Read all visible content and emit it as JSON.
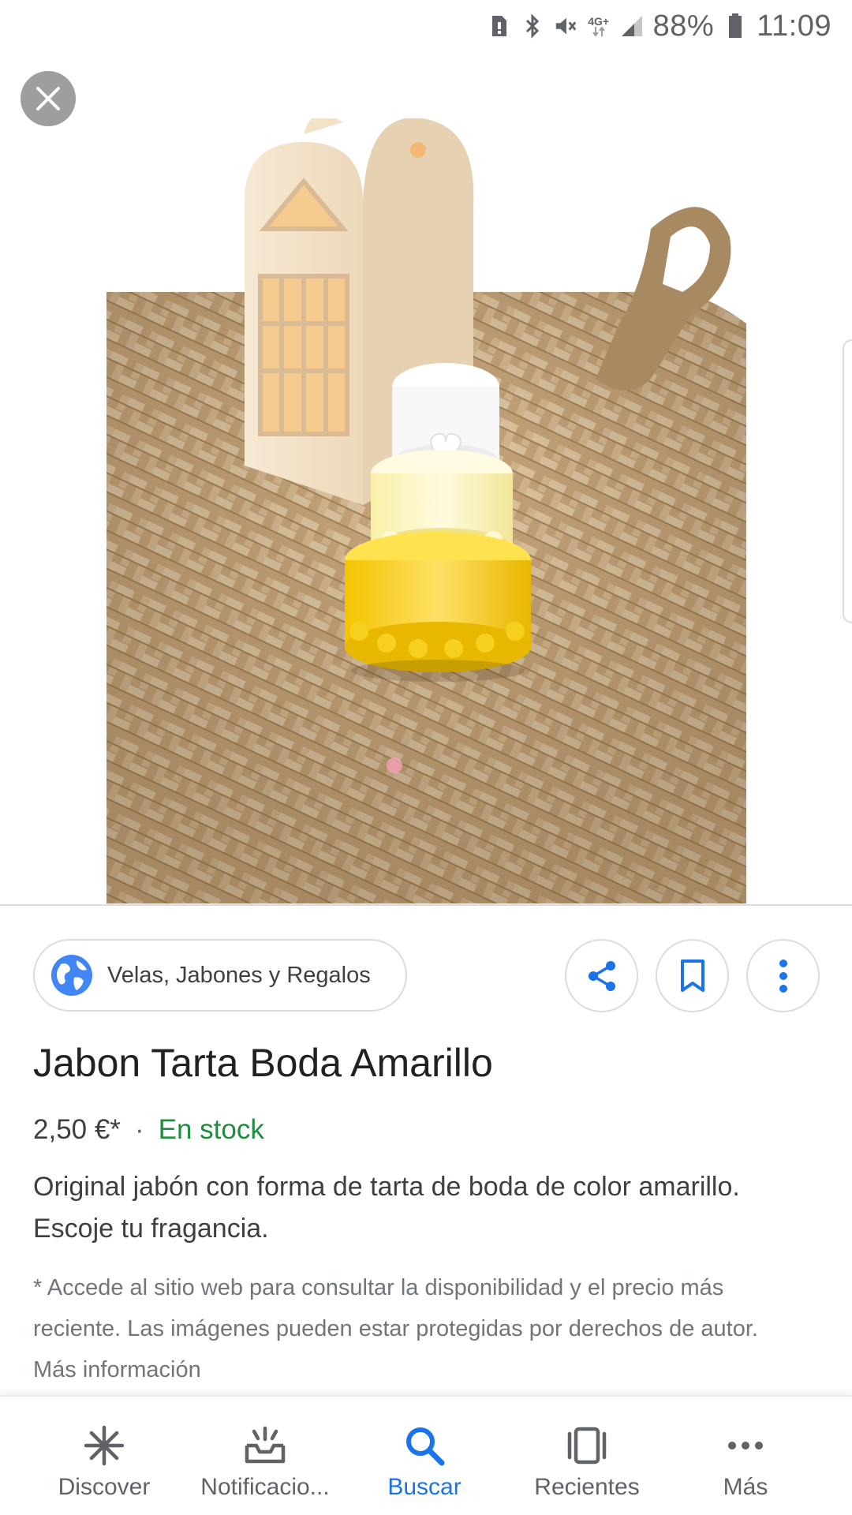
{
  "status_bar": {
    "network": "4G+",
    "battery": "88%",
    "time": "11:09"
  },
  "result": {
    "image_alt": "Jabón tarta boda amarillo sobre abanico de mimbre con caja de regalo",
    "source": "Velas, Jabones y Regalos",
    "title": "Jabon Tarta Boda Amarillo",
    "price": "2,50 €*",
    "separator": "·",
    "stock": "En stock",
    "description": "Original jabón con forma de tarta de boda de color amarillo. Escoje tu fragancia.",
    "note": "* Accede al sitio web para consultar la disponibilidad y el precio más reciente. Las imágenes pueden estar protegidas por derechos de autor. Más información"
  },
  "actions": {
    "share": "share-icon",
    "save": "bookmark-icon",
    "more": "more-vert-icon"
  },
  "nav": [
    {
      "label": "Discover",
      "icon": "discover-icon"
    },
    {
      "label": "Notificacio...",
      "icon": "notifications-icon"
    },
    {
      "label": "Buscar",
      "icon": "search-icon",
      "active": true
    },
    {
      "label": "Recientes",
      "icon": "recents-icon"
    },
    {
      "label": "Más",
      "icon": "more-horiz-icon"
    }
  ],
  "colors": {
    "accent": "#1a73e8",
    "stock": "#1e8e3e",
    "close_bg": "#9e9e9e"
  }
}
